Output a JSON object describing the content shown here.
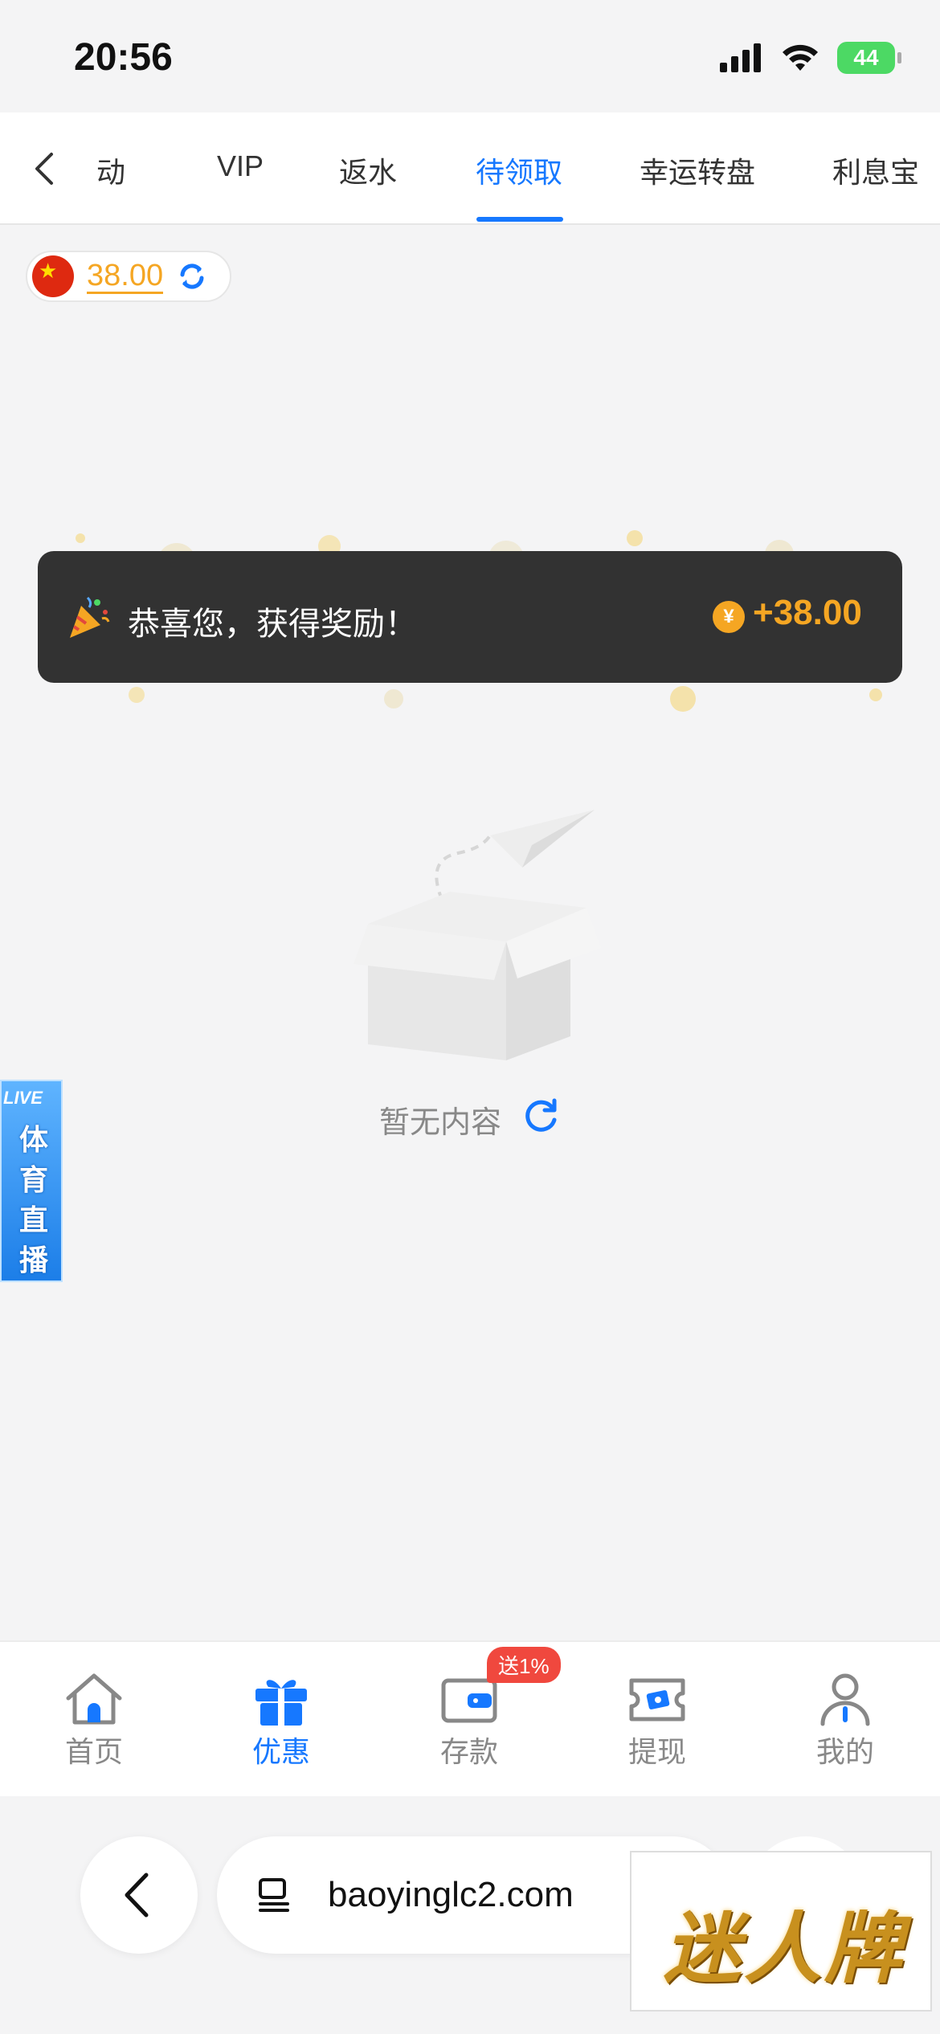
{
  "status_bar": {
    "time": "20:56",
    "battery": "44"
  },
  "tabs": [
    {
      "label": "活动",
      "visible": "动"
    },
    {
      "label": "VIP"
    },
    {
      "label": "返水"
    },
    {
      "label": "待领取",
      "active": true
    },
    {
      "label": "幸运转盘"
    },
    {
      "label": "利息宝"
    }
  ],
  "balance": {
    "value": "38.00"
  },
  "toast": {
    "message": "恭喜您，获得奖励！",
    "currency": "¥",
    "amount": "+38.00"
  },
  "empty_state": {
    "text": "暂无内容"
  },
  "live_float": {
    "tag": "LIVE",
    "words": [
      "体",
      "育",
      "直",
      "播"
    ]
  },
  "bottom_nav": {
    "items": [
      {
        "label": "首页",
        "icon": "home-icon"
      },
      {
        "label": "优惠",
        "icon": "gift-icon",
        "active": true
      },
      {
        "label": "存款",
        "icon": "wallet-icon"
      },
      {
        "label": "提现",
        "icon": "withdraw-icon"
      },
      {
        "label": "我的",
        "icon": "user-icon"
      }
    ],
    "deposit_badge": "送1%"
  },
  "browser": {
    "url": "baoyinglc2.com"
  },
  "watermark": {
    "text": "迷人牌"
  },
  "colors": {
    "accent": "#1678ff",
    "gold": "#f5a623",
    "toast_bg": "#323232",
    "badge": "#f0483e"
  }
}
